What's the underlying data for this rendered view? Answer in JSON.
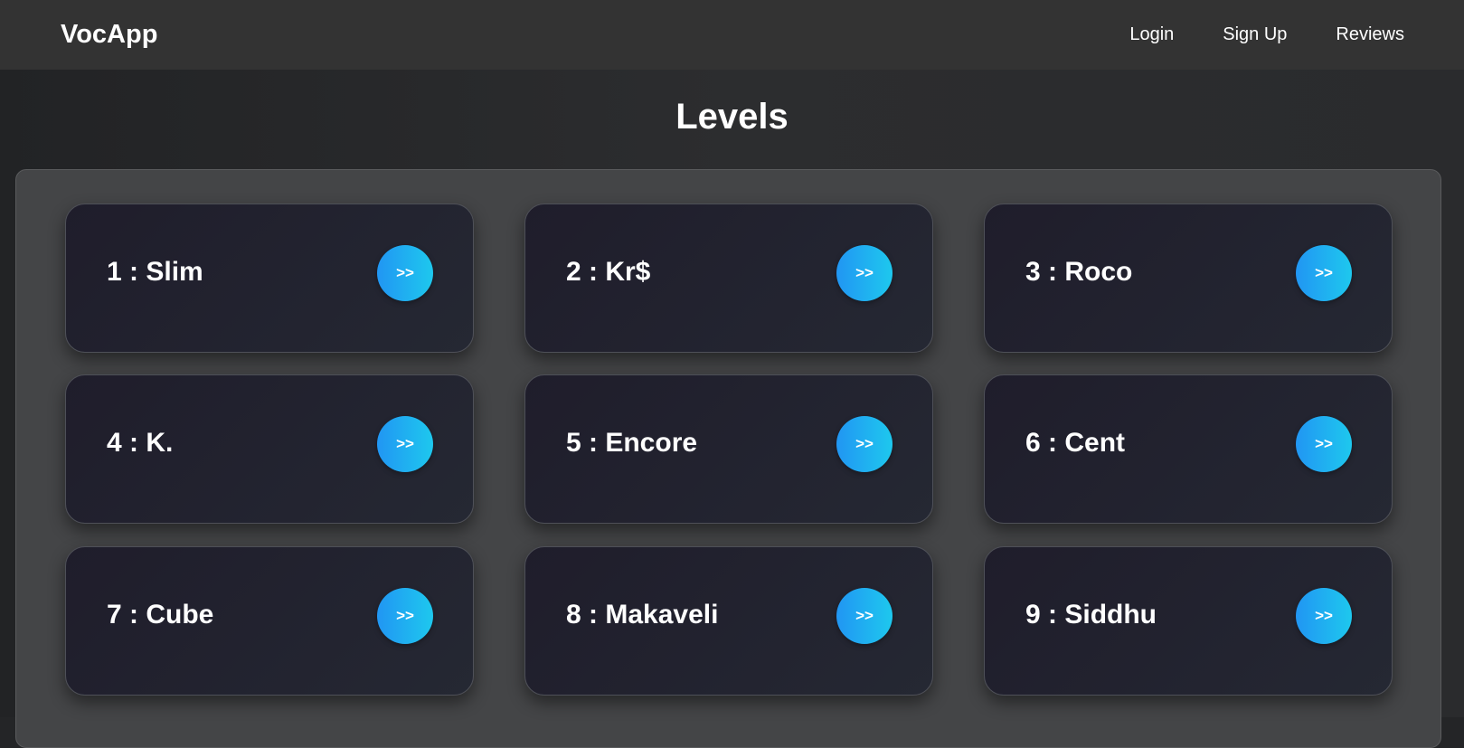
{
  "navbar": {
    "brand": "VocApp",
    "links": [
      "Login",
      "Sign Up",
      "Reviews"
    ]
  },
  "page": {
    "title": "Levels"
  },
  "levels": [
    {
      "label": "1 : Slim",
      "button": ">>"
    },
    {
      "label": "2 : Kr$",
      "button": ">>"
    },
    {
      "label": "3 : Roco",
      "button": ">>"
    },
    {
      "label": "4 : K.",
      "button": ">>"
    },
    {
      "label": "5 : Encore",
      "button": ">>"
    },
    {
      "label": "6 : Cent",
      "button": ">>"
    },
    {
      "label": "7 : Cube",
      "button": ">>"
    },
    {
      "label": "8 : Makaveli",
      "button": ">>"
    },
    {
      "label": "9 : Siddhu",
      "button": ">>"
    }
  ],
  "colors": {
    "navbar": "#333333",
    "panel": "#444547",
    "card": "#1f1d2b",
    "button_start": "#2196f3",
    "button_end": "#1ec8ee"
  }
}
